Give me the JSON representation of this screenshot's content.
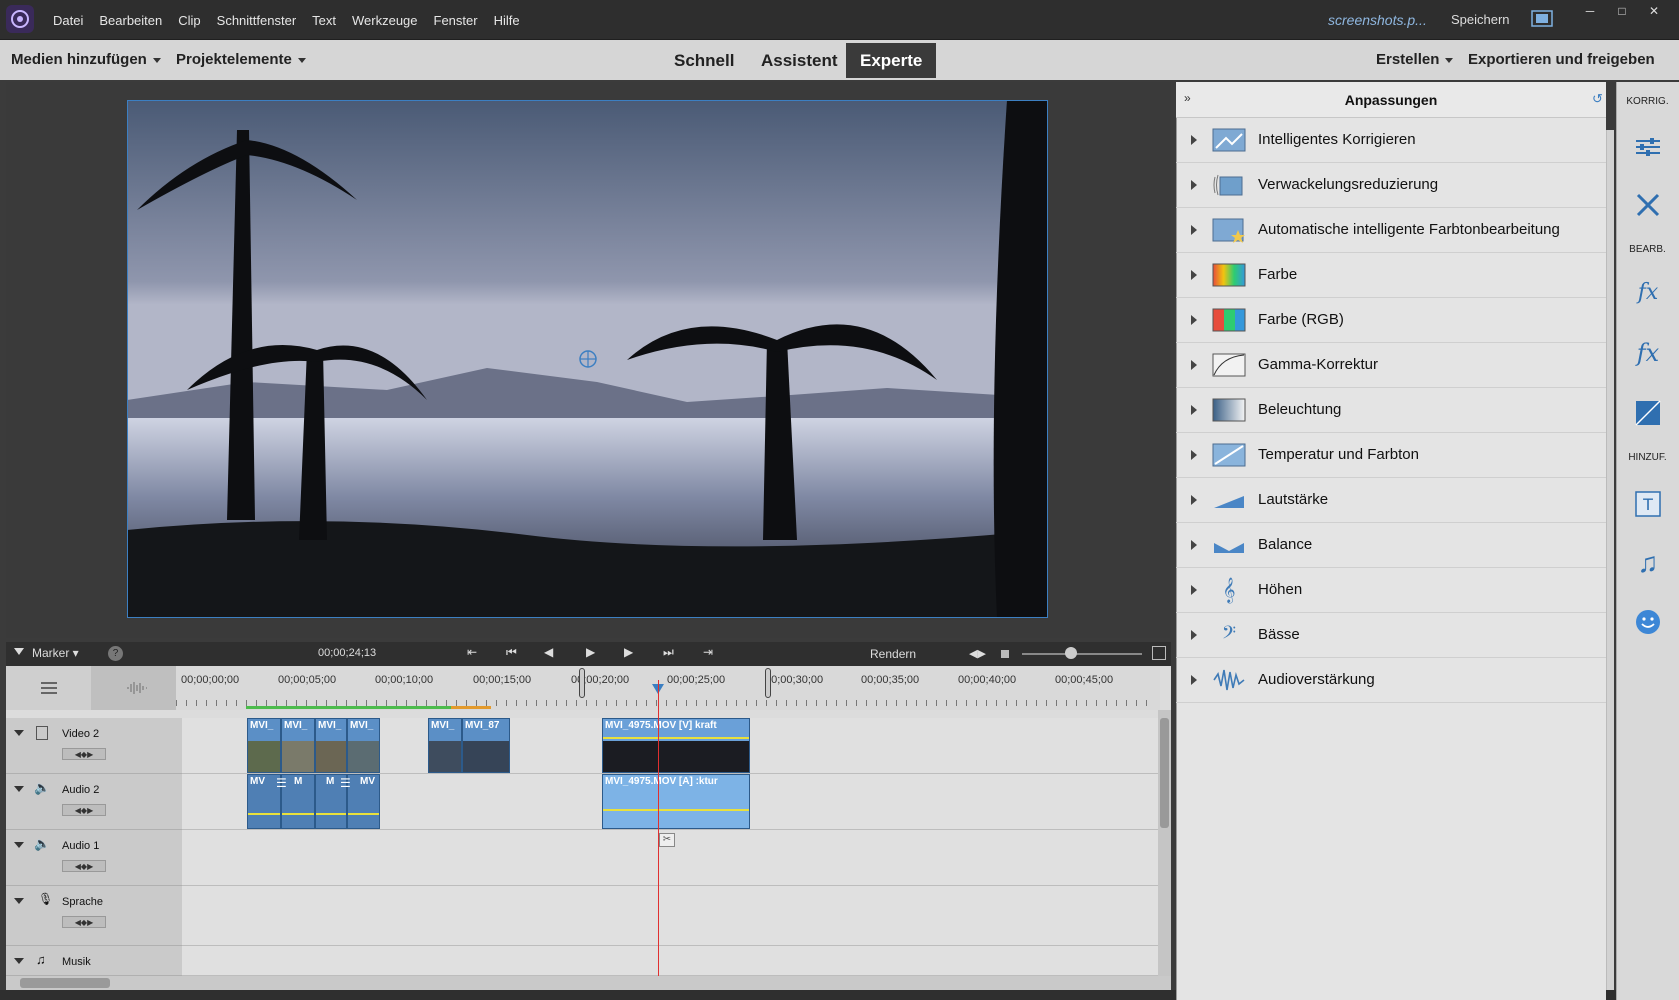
{
  "menubar": {
    "items": [
      "Datei",
      "Bearbeiten",
      "Clip",
      "Schnittfenster",
      "Text",
      "Werkzeuge",
      "Fenster",
      "Hilfe"
    ],
    "site": "screenshots.p...",
    "save": "Speichern"
  },
  "topbar": {
    "add_media": "Medien hinzufügen",
    "project_elements": "Projektelemente",
    "modes": [
      "Schnell",
      "Assistent",
      "Experte"
    ],
    "active_mode": "Experte",
    "create": "Erstellen",
    "export": "Exportieren und freigeben"
  },
  "timeline_bar": {
    "marker": "Marker",
    "timecode": "00;00;24;13",
    "render": "Rendern"
  },
  "ruler": {
    "ticks": [
      "00;00;00;00",
      "00;00;05;00",
      "00;00;10;00",
      "00;00;15;00",
      "00;00;20;00",
      "00;00;25;00",
      "00;00;30;00",
      "00;00;35;00",
      "00;00;40;00",
      "00;00;45;00"
    ]
  },
  "tracks": [
    {
      "name": "Video 2",
      "kind": "video"
    },
    {
      "name": "Audio 2",
      "kind": "audio"
    },
    {
      "name": "Audio 1",
      "kind": "audio"
    },
    {
      "name": "Sprache",
      "kind": "voice"
    },
    {
      "name": "Musik",
      "kind": "music"
    }
  ],
  "clips": {
    "v_a": "MVI_",
    "v_b": "MVI_",
    "v_c": "MVI_",
    "v_d": "MVI_",
    "v_e": "MVI_",
    "v_f": "MVI_87",
    "v_main": "MVI_4975.MOV [V]  kraft",
    "a_a": "MV",
    "a_b": "M",
    "a_c": "M",
    "a_d": "MV",
    "a_main": "MVI_4975.MOV [A]  :ktur"
  },
  "panel": {
    "title": "Anpassungen",
    "items": [
      "Intelligentes Korrigieren",
      "Verwackelungsreduzierung",
      "Automatische intelligente Farbtonbearbeitung",
      "Farbe",
      "Farbe (RGB)",
      "Gamma-Korrektur",
      "Beleuchtung",
      "Temperatur und Farbton",
      "Lautstärke",
      "Balance",
      "Höhen",
      "Bässe",
      "Audioverstärkung"
    ]
  },
  "toolbar": {
    "korrig": "KORRIG.",
    "bearb": "BEARB.",
    "hinzuf": "HINZUF."
  },
  "colors": {
    "accent": "#3c7fc2",
    "playhead": "#e03030",
    "clip": "#5b8fc6"
  }
}
